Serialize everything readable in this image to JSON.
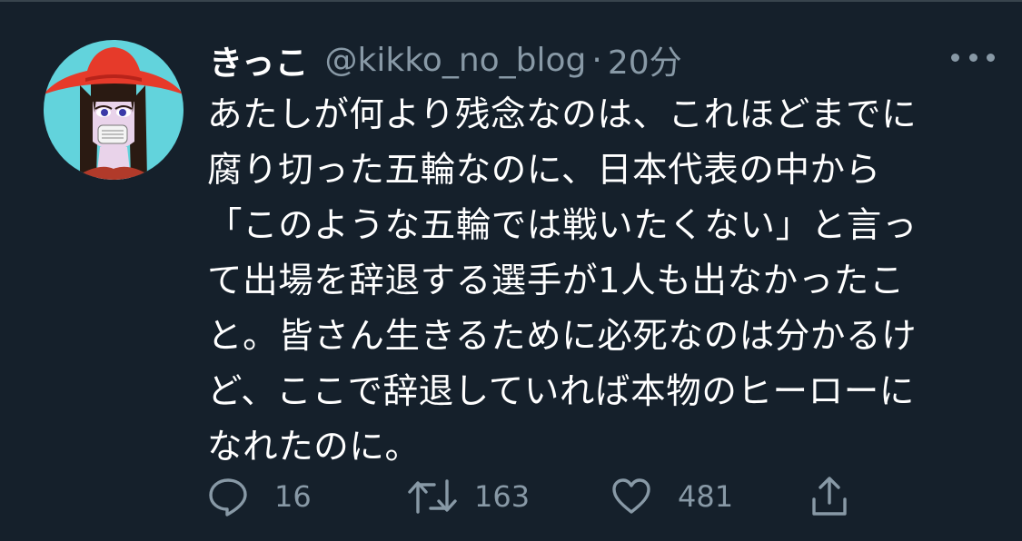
{
  "tweet": {
    "display_name": "きっこ",
    "handle": "@kikko_no_blog",
    "separator": "·",
    "time": "20分",
    "body_lines": [
      "あたしが何より残念なのは、これほどまでに",
      "腐り切った五輪なのに、日本代表の中から",
      "「このような五輪では戦いたくない」と言っ",
      "て出場を辞退する選手が1人も出なかったこ",
      "と。皆さん生きるために必死なのは分かるけ",
      "ど、ここで辞退していれば本物のヒーローに",
      "なれたのに。"
    ],
    "actions": {
      "reply_count": "16",
      "retweet_count": "163",
      "like_count": "481"
    }
  },
  "icons": {
    "more": "more-horizontal-icon",
    "reply": "speech-bubble-icon",
    "retweet": "retweet-arrows-icon",
    "like": "heart-icon",
    "share": "share-upload-icon"
  },
  "colors": {
    "background": "#15202b",
    "primary_text": "#ffffff",
    "secondary_text": "#8899a6",
    "divider": "#38444d"
  }
}
